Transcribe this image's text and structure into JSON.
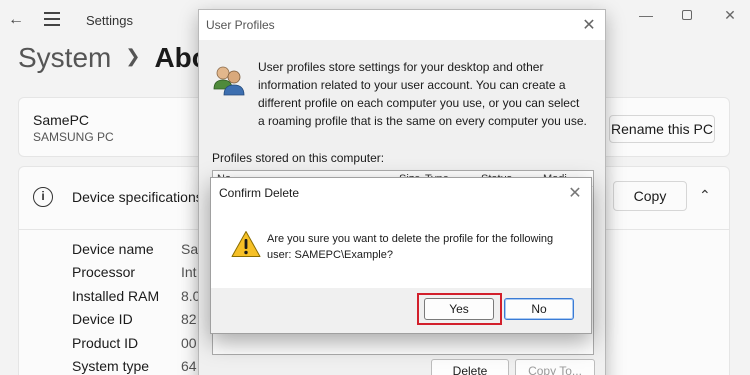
{
  "settings": {
    "app_title": "Settings",
    "breadcrumb": {
      "parent": "System",
      "current": "Abou"
    },
    "pc": {
      "name": "SamePC",
      "model": "SAMSUNG PC",
      "rename_label": "Rename this PC"
    },
    "specs": {
      "title": "Device specifications",
      "copy_label": "Copy",
      "rows": [
        {
          "label": "Device name",
          "value": "Sa"
        },
        {
          "label": "Processor",
          "value": "Int"
        },
        {
          "label": "Installed RAM",
          "value": "8.0"
        },
        {
          "label": "Device ID",
          "value": "82"
        },
        {
          "label": "Product ID",
          "value": "00"
        },
        {
          "label": "System type",
          "value": "64"
        }
      ]
    },
    "icons": {
      "back": "back-arrow-icon",
      "menu": "hamburger-menu-icon",
      "info": "info-icon",
      "collapse": "chevron-up-icon"
    }
  },
  "user_profiles": {
    "title": "User Profiles",
    "description": "User profiles store settings for your desktop and other information related to your user account. You can create a different profile on each computer you use, or you can select a roaming profile that is the same on every computer you use.",
    "list_label": "Profiles stored on this computer:",
    "columns": [
      "Na",
      "Size",
      "Type",
      "Status",
      "Modi"
    ],
    "buttons": {
      "delete": "Delete",
      "copy_to": "Copy To..."
    }
  },
  "confirm_delete": {
    "title": "Confirm Delete",
    "message": "Are you sure you want to delete the profile for the following user: SAMEPC\\Example?",
    "yes_label": "Yes",
    "no_label": "No",
    "highlight_color": "#d21f2b"
  }
}
